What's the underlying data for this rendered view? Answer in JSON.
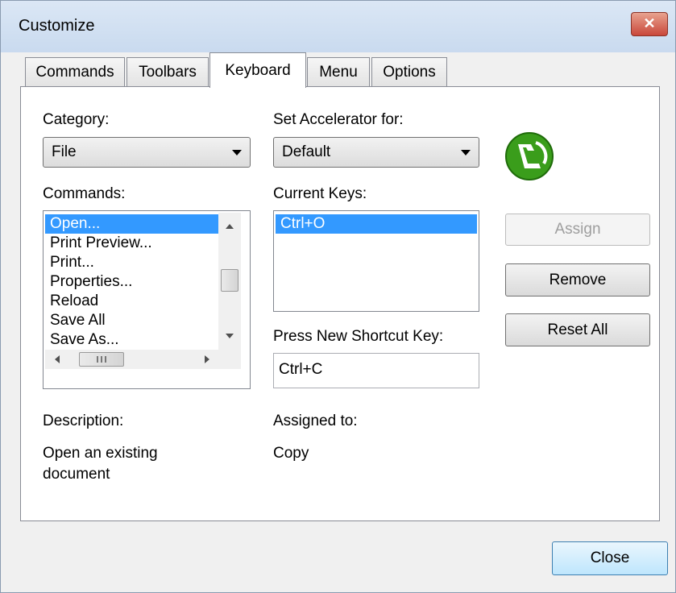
{
  "window": {
    "title": "Customize",
    "close_glyph": "✕"
  },
  "tabs": [
    {
      "label": "Commands"
    },
    {
      "label": "Toolbars"
    },
    {
      "label": "Keyboard"
    },
    {
      "label": "Menu"
    },
    {
      "label": "Options"
    }
  ],
  "category": {
    "label": "Category:",
    "value": "File"
  },
  "accelerator": {
    "label": "Set Accelerator for:",
    "value": "Default"
  },
  "commands": {
    "label": "Commands:",
    "items": [
      "Open...",
      "Print Preview...",
      "Print...",
      "Properties...",
      "Reload",
      "Save All",
      "Save As..."
    ],
    "selected_index": 0
  },
  "current_keys": {
    "label": "Current Keys:",
    "items": [
      "Ctrl+O"
    ]
  },
  "shortcut": {
    "label": "Press New Shortcut Key:",
    "value": "Ctrl+C"
  },
  "buttons": {
    "assign": "Assign",
    "remove": "Remove",
    "reset_all": "Reset All",
    "close": "Close"
  },
  "description": {
    "label": "Description:",
    "text_line1": "Open an existing",
    "text_line2": "document"
  },
  "assigned_to": {
    "label": "Assigned to:",
    "value": "Copy"
  },
  "icons": {
    "scroll_up": "scroll-up-arrow",
    "scroll_down": "scroll-down-arrow",
    "scroll_left": "scroll-left-arrow",
    "scroll_right": "scroll-right-arrow",
    "app_logo": "altova-logo"
  },
  "colors": {
    "selection": "#3399ff",
    "logo_green": "#3a9d1b"
  }
}
